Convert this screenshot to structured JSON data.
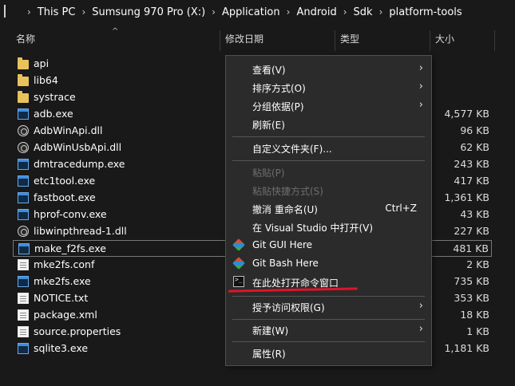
{
  "address_bar": {
    "crumbs": [
      "This PC",
      "Sumsung 970 Pro (X:)",
      "Application",
      "Android",
      "Sdk",
      "platform-tools"
    ],
    "separator": "›"
  },
  "header": {
    "name": "名称",
    "modified": "修改日期",
    "type": "类型",
    "size": "大小",
    "sort_icon": "^"
  },
  "files": [
    {
      "name": "api",
      "icon": "folder-icon",
      "size": ""
    },
    {
      "name": "lib64",
      "icon": "folder-icon",
      "size": ""
    },
    {
      "name": "systrace",
      "icon": "folder-icon",
      "size": ""
    },
    {
      "name": "adb.exe",
      "icon": "exe-icon",
      "size": "4,577 KB"
    },
    {
      "name": "AdbWinApi.dll",
      "icon": "dll-icon",
      "size": "96 KB"
    },
    {
      "name": "AdbWinUsbApi.dll",
      "icon": "dll-icon",
      "size": "62 KB"
    },
    {
      "name": "dmtracedump.exe",
      "icon": "exe-icon",
      "size": "243 KB"
    },
    {
      "name": "etc1tool.exe",
      "icon": "exe-icon",
      "size": "417 KB"
    },
    {
      "name": "fastboot.exe",
      "icon": "exe-icon",
      "size": "1,361 KB"
    },
    {
      "name": "hprof-conv.exe",
      "icon": "exe-icon",
      "size": "43 KB"
    },
    {
      "name": "libwinpthread-1.dll",
      "icon": "dll-icon",
      "size": "227 KB"
    },
    {
      "name": "make_f2fs.exe",
      "icon": "exe-icon",
      "size": "481 KB",
      "selected": true
    },
    {
      "name": "mke2fs.conf",
      "icon": "doc-icon",
      "size": "2 KB"
    },
    {
      "name": "mke2fs.exe",
      "icon": "exe-icon",
      "size": "735 KB"
    },
    {
      "name": "NOTICE.txt",
      "icon": "doc-icon",
      "size": "353 KB"
    },
    {
      "name": "package.xml",
      "icon": "doc-icon",
      "size": "18 KB"
    },
    {
      "name": "source.properties",
      "icon": "doc-icon",
      "size": "1 KB"
    },
    {
      "name": "sqlite3.exe",
      "icon": "exe-icon",
      "size": "1,181 KB"
    }
  ],
  "context_menu": {
    "items": [
      {
        "label": "查看(V)",
        "arrow": "›"
      },
      {
        "label": "排序方式(O)",
        "arrow": "›"
      },
      {
        "label": "分组依据(P)",
        "arrow": "›"
      },
      {
        "label": "刷新(E)"
      },
      {
        "label": "自定义文件夹(F)..."
      },
      {
        "label": "粘贴(P)",
        "disabled": true
      },
      {
        "label": "粘贴快捷方式(S)",
        "disabled": true
      },
      {
        "label": "撤消 重命名(U)",
        "shortcut": "Ctrl+Z"
      },
      {
        "label": "在 Visual Studio 中打开(V)"
      },
      {
        "label": "Git GUI Here",
        "icon": "git-icon"
      },
      {
        "label": "Git Bash Here",
        "icon": "git-icon"
      },
      {
        "label": "在此处打开命令窗口",
        "icon": "cmd-icon"
      },
      {
        "label": "授予访问权限(G)",
        "arrow": "›"
      },
      {
        "label": "新建(W)",
        "arrow": "›"
      },
      {
        "label": "属性(R)"
      }
    ]
  },
  "colors": {
    "background": "#191919",
    "menu_background": "#2b2b2b",
    "highlight_underline": "#e0142a",
    "folder": "#e9c25c"
  }
}
